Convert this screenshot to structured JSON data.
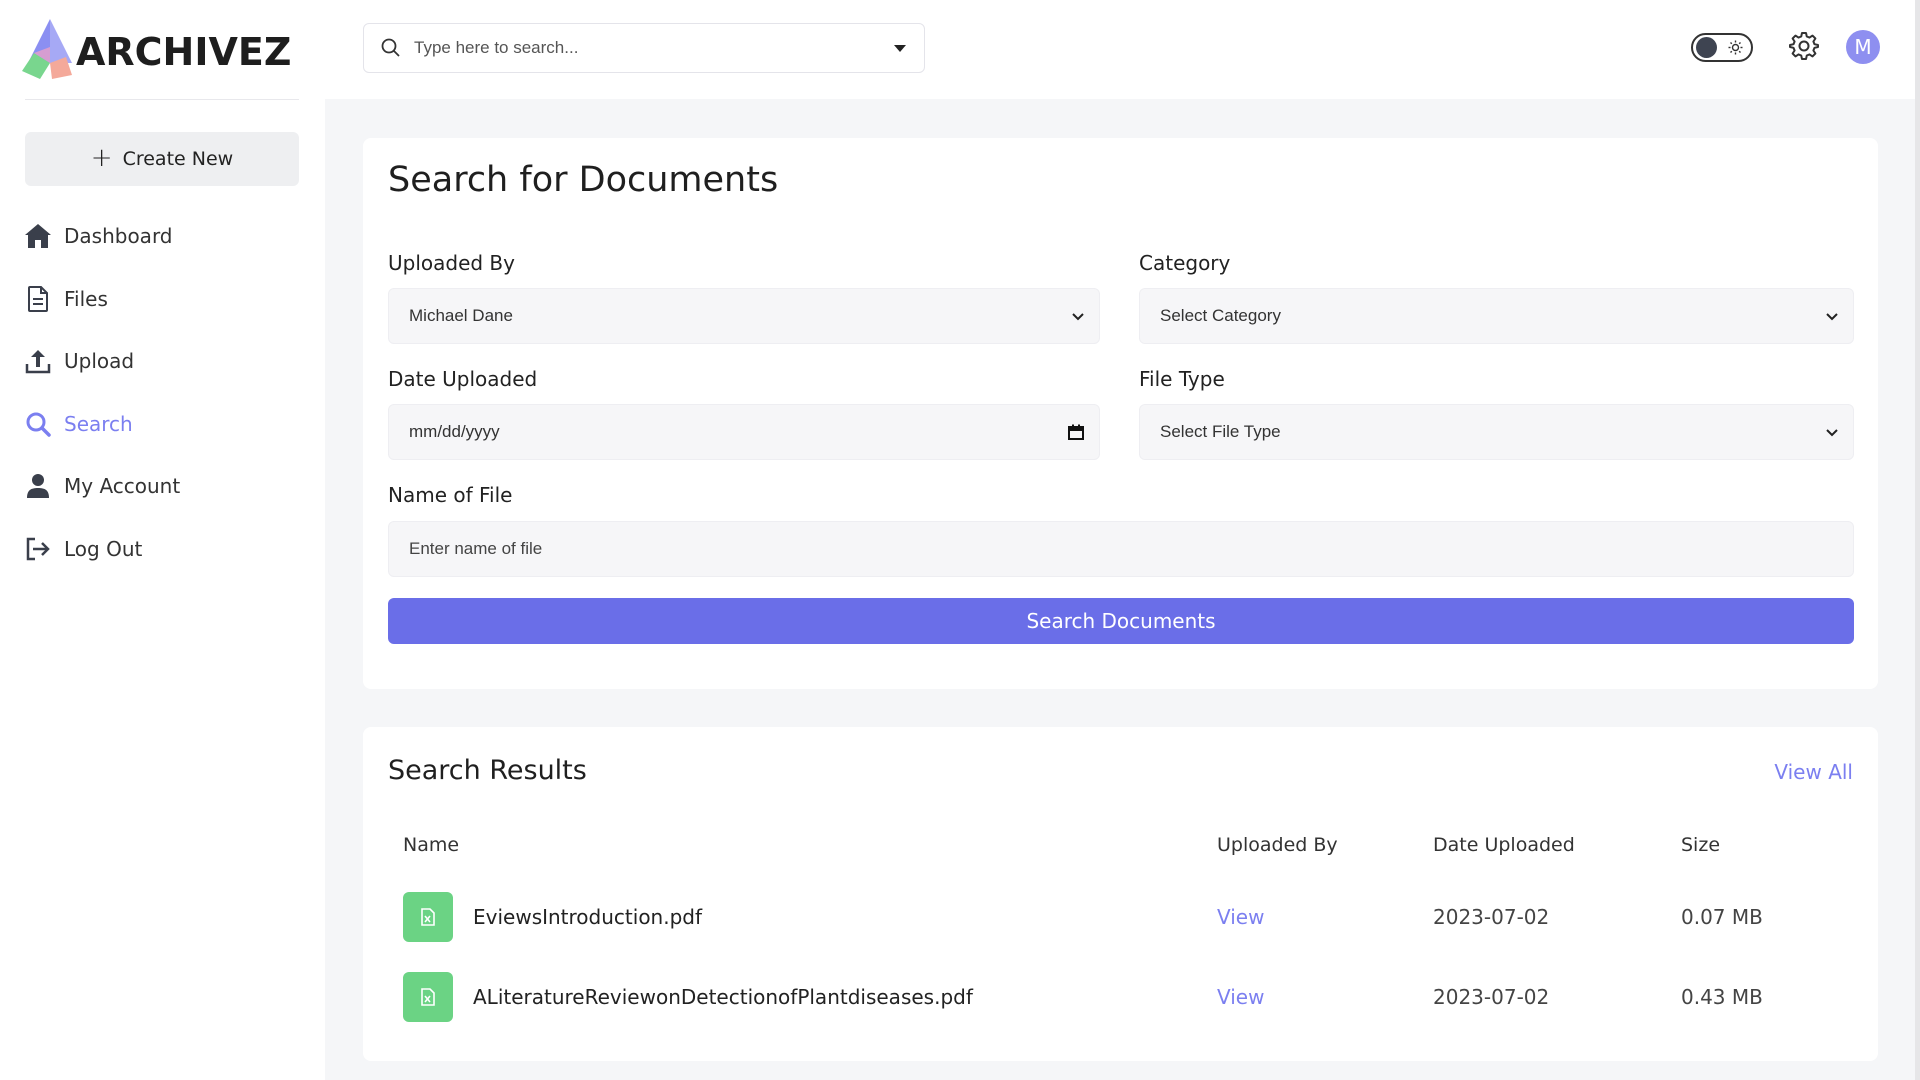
{
  "app": {
    "logo_text": "ARCHIVEZ",
    "accent_color": "#6a6ee8",
    "link_color": "#7b7ff0",
    "file_icon_color": "#6bd384"
  },
  "sidebar": {
    "create_label": "Create New",
    "items": [
      {
        "label": "Dashboard",
        "icon": "home-icon"
      },
      {
        "label": "Files",
        "icon": "file-icon"
      },
      {
        "label": "Upload",
        "icon": "upload-icon"
      },
      {
        "label": "Search",
        "icon": "search-icon",
        "active": true
      },
      {
        "label": "My Account",
        "icon": "user-icon"
      },
      {
        "label": "Log Out",
        "icon": "logout-icon"
      }
    ]
  },
  "topbar": {
    "search_placeholder": "Type here to search...",
    "avatar_initial": "M"
  },
  "search_form": {
    "title": "Search for Documents",
    "uploaded_by": {
      "label": "Uploaded By",
      "value": "Michael Dane"
    },
    "category": {
      "label": "Category",
      "value": "Select Category"
    },
    "date_uploaded": {
      "label": "Date Uploaded",
      "value": "mm/dd/yyyy"
    },
    "file_type": {
      "label": "File Type",
      "value": "Select File Type"
    },
    "name_of_file": {
      "label": "Name of File",
      "placeholder": "Enter name of file"
    },
    "submit_label": "Search Documents"
  },
  "results": {
    "title": "Search Results",
    "view_all_label": "View All",
    "columns": [
      "Name",
      "Uploaded By",
      "Date Uploaded",
      "Size"
    ],
    "rows": [
      {
        "name": "EviewsIntroduction.pdf",
        "uploaded_by": "View",
        "date": "2023-07-02",
        "size": "0.07 MB"
      },
      {
        "name": "ALiteratureReviewonDetectionofPlantdiseases.pdf",
        "uploaded_by": "View",
        "date": "2023-07-02",
        "size": "0.43 MB"
      }
    ]
  }
}
